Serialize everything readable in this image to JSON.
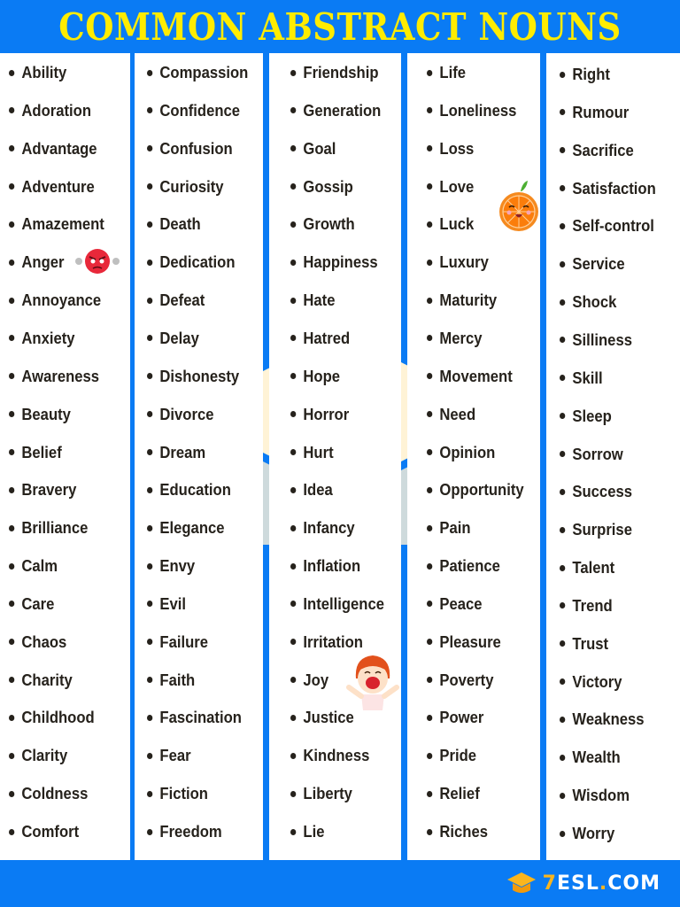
{
  "header": {
    "title": "COMMON ABSTRACT NOUNS"
  },
  "colors": {
    "background_blue": "#0a7bf4",
    "title_yellow": "#ffec00",
    "text_dark": "#26221c",
    "logo_orange": "#fbb51d",
    "watermark": "#fff3d6"
  },
  "columns": [
    {
      "items": [
        "Ability",
        "Adoration",
        "Advantage",
        "Adventure",
        "Amazement",
        "Anger",
        "Annoyance",
        "Anxiety",
        "Awareness",
        "Beauty",
        "Belief",
        "Bravery",
        "Brilliance",
        "Calm",
        "Care",
        "Chaos",
        "Charity",
        "Childhood",
        "Clarity",
        "Coldness",
        "Comfort"
      ]
    },
    {
      "items": [
        "Compassion",
        "Confidence",
        "Confusion",
        "Curiosity",
        "Death",
        "Dedication",
        "Defeat",
        "Delay",
        "Dishonesty",
        "Divorce",
        "Dream",
        "Education",
        "Elegance",
        "Envy",
        "Evil",
        "Failure",
        "Faith",
        "Fascination",
        "Fear",
        "Fiction",
        "Freedom"
      ]
    },
    {
      "items": [
        "Friendship",
        "Generation",
        "Goal",
        "Gossip",
        "Growth",
        "Happiness",
        "Hate",
        "Hatred",
        "Hope",
        "Horror",
        "Hurt",
        "Idea",
        "Infancy",
        "Inflation",
        "Intelligence",
        "Irritation",
        "Joy",
        "Justice",
        "Kindness",
        "Liberty",
        "Lie"
      ]
    },
    {
      "items": [
        "Life",
        "Loneliness",
        "Loss",
        "Love",
        "Luck",
        "Luxury",
        "Maturity",
        "Mercy",
        "Movement",
        "Need",
        "Opinion",
        "Opportunity",
        "Pain",
        "Patience",
        "Peace",
        "Pleasure",
        "Poverty",
        "Power",
        "Pride",
        "Relief",
        "Riches"
      ]
    },
    {
      "items": [
        "Right",
        "Rumour",
        "Sacrifice",
        "Satisfaction",
        "Self-control",
        "Service",
        "Shock",
        "Silliness",
        "Skill",
        "Sleep",
        "Sorrow",
        "Success",
        "Surprise",
        "Talent",
        "Trend",
        "Trust",
        "Victory",
        "Weakness",
        "Wealth",
        "Wisdom",
        "Worry"
      ]
    }
  ],
  "stickers": [
    {
      "name": "angry-face",
      "next_to": "Anger"
    },
    {
      "name": "smiling-orange",
      "next_to": "Love / Luck"
    },
    {
      "name": "laughing-child",
      "next_to": "Joy"
    }
  ],
  "footer": {
    "logo_prefix": "7",
    "logo_main": "ESL",
    "logo_dot": ".",
    "logo_suffix": "COM"
  }
}
